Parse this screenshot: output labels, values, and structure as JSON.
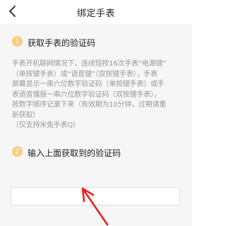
{
  "header": {
    "title": "绑定手表",
    "back_icon": "chevron-left-icon"
  },
  "step1": {
    "number": "1",
    "title": "获取手表的验证码",
    "description_lines": [
      "手表开机联网情况下，连续短按16次手表“电源键”",
      "（单按键手表）或“语音键”（双按键手表），手表",
      "屏幕显示一串六位数字验证码（单按键手表）或手",
      "表语音播报一串六位数字验证码（双按键手表），",
      "按数字顺序记录下来（有效期为10分钟，过期请重",
      "新获取）",
      "（仅支持米兔手表Q）"
    ]
  },
  "step2": {
    "number": "2",
    "title": "输入上面获取到的验证码",
    "input_value": "",
    "input_placeholder": ""
  },
  "annotation": {
    "arrow_color": "#e8231f"
  },
  "colors": {
    "badge": "#f6ce7c",
    "background": "#f6f6f6",
    "description": "#999999"
  }
}
